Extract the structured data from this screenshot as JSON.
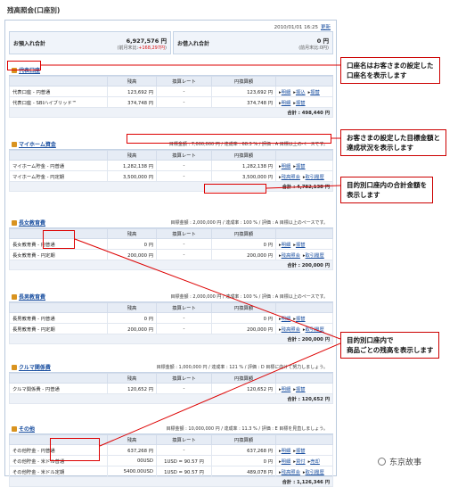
{
  "page_title": "残高照会(口座別)",
  "timestamp": "2010/01/01 16:25",
  "update_label": "更新",
  "deposit": {
    "label": "お預入れ合計",
    "amount": "6,927,576 円",
    "prev_label": "(前月末比:",
    "prev_change": "+168,297円",
    "prev_close": ")"
  },
  "borrow": {
    "label": "お借入れ合計",
    "amount": "0 円",
    "prev": "(前月末比:0円)"
  },
  "columns": [
    "",
    "残高",
    "換算レート",
    "円換算額",
    ""
  ],
  "sections": [
    {
      "title": "代表口座",
      "goal": "",
      "rows": [
        {
          "name": "代表口座 - 円普通",
          "balance": "123,692 円",
          "rate": "-",
          "yen": "123,692 円",
          "actions": [
            "明細",
            "振込",
            "振替"
          ]
        },
        {
          "name": "代表口座 - SBIハイブリッド™",
          "balance": "374,748 円",
          "rate": "-",
          "yen": "374,748 円",
          "actions": [
            "明細",
            "振替"
          ]
        }
      ],
      "total": "合計 : 498,440 円"
    },
    {
      "title": "マイホーム資金",
      "goal": "目標金額 : 7,000,000 円 / 達成率 : 68.3 % / 評価 : A 目標以上のペースです。",
      "rows": [
        {
          "name": "マイホーム貯金 - 円普通",
          "balance": "1,282,138 円",
          "rate": "-",
          "yen": "1,282,138 円",
          "actions": [
            "明細",
            "振替"
          ]
        },
        {
          "name": "マイホーム貯金 - 円定期",
          "balance": "3,500,000 円",
          "rate": "-",
          "yen": "3,500,000 円",
          "actions": [
            "残高照会",
            "取引履歴"
          ]
        }
      ],
      "total": "合計 : 4,782,138 円"
    },
    {
      "title": "長女教育費",
      "goal": "目標金額 : 2,000,000 円 / 達成率 : 100 % / 評価 : A 目標以上のペースです。",
      "rows": [
        {
          "name": "長女教育費 - 円普通",
          "balance": "0 円",
          "rate": "-",
          "yen": "0 円",
          "actions": [
            "明細",
            "振替"
          ]
        },
        {
          "name": "長女教育費 - 円定期",
          "balance": "200,000 円",
          "rate": "-",
          "yen": "200,000 円",
          "actions": [
            "残高照会",
            "取引履歴"
          ]
        }
      ],
      "total": "合計 : 200,000 円"
    },
    {
      "title": "長男教育費",
      "goal": "目標金額 : 2,000,000 円 / 達成率 : 100 % / 評価 : A 目標以上のペースです。",
      "rows": [
        {
          "name": "長男教育費 - 円普通",
          "balance": "0 円",
          "rate": "-",
          "yen": "0 円",
          "actions": [
            "明細",
            "振替"
          ]
        },
        {
          "name": "長男教育費 - 円定期",
          "balance": "200,000 円",
          "rate": "-",
          "yen": "200,000 円",
          "actions": [
            "残高照会",
            "取引履歴"
          ]
        }
      ],
      "total": "合計 : 200,000 円"
    },
    {
      "title": "クルマ関係費",
      "goal": "目標金額 : 1,000,000 円 / 達成率 : 121 % / 評価 : D 目標に向けて努力しましょう。",
      "rows": [
        {
          "name": "クルマ関係費 - 円普通",
          "balance": "120,652 円",
          "rate": "-",
          "yen": "120,652 円",
          "actions": [
            "明細",
            "振替"
          ]
        }
      ],
      "total": "合計 : 120,652 円"
    },
    {
      "title": "その他",
      "goal": "目標金額 : 10,000,000 円 / 達成率 : 11.3 % / 評価 : E 目標を見直しましょう。",
      "rows": [
        {
          "name": "その他貯金 - 円普通",
          "balance": "637,268 円",
          "rate": "-",
          "yen": "637,268 円",
          "actions": [
            "明細",
            "振替"
          ]
        },
        {
          "name": "その他貯金 - 米ドル普通",
          "balance": "00USD",
          "rate": "1USD = 90.57 円",
          "yen": "0 円",
          "actions": [
            "明細",
            "買付",
            "売却"
          ]
        },
        {
          "name": "その他貯金 - 米ドル定期",
          "balance": "5400.00USD",
          "rate": "1USD = 90.57 円",
          "yen": "489,078 円",
          "actions": [
            "残高照会",
            "取引履歴"
          ]
        }
      ],
      "total": "合計 : 1,126,346 円"
    }
  ],
  "callouts": {
    "c1": "口座名はお客さまの設定した\n口座名を表示します",
    "c2": "お客さまの設定した目標金額と\n達成状況を表示します",
    "c3": "目的別口座内の合計金額を\n表示します",
    "c4": "目的別口座内で\n商品ごとの残高を表示します"
  },
  "watermark": "东京故事",
  "accent_color": "#1a4fa0",
  "callout_color": "#cc0000"
}
